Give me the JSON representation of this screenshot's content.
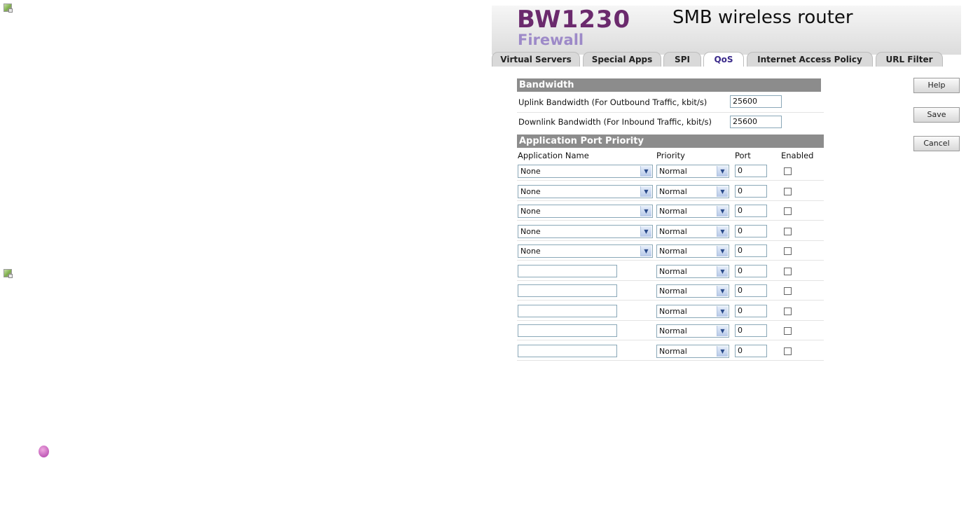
{
  "header": {
    "brand": "BW1230",
    "tagline": "SMB wireless router",
    "section": "Firewall"
  },
  "tabs": [
    {
      "label": "Virtual Servers"
    },
    {
      "label": "Special Apps"
    },
    {
      "label": "SPI"
    },
    {
      "label": "QoS"
    },
    {
      "label": "Internet Access Policy"
    },
    {
      "label": "URL Filter"
    }
  ],
  "active_tab": "QoS",
  "buttons": {
    "help": "Help",
    "save": "Save",
    "cancel": "Cancel"
  },
  "bandwidth": {
    "title": "Bandwidth",
    "uplink_label": "Uplink Bandwidth (For Outbound Traffic, kbit/s)",
    "uplink_value": "25600",
    "downlink_label": "Downlink Bandwidth (For Inbound Traffic, kbit/s)",
    "downlink_value": "25600"
  },
  "priority": {
    "title": "Application Port Priority",
    "columns": {
      "app": "Application Name",
      "priority": "Priority",
      "port": "Port",
      "enabled": "Enabled"
    },
    "rows": [
      {
        "app": "None",
        "priority": "Normal",
        "port": "0"
      },
      {
        "app": "None",
        "priority": "Normal",
        "port": "0"
      },
      {
        "app": "None",
        "priority": "Normal",
        "port": "0"
      },
      {
        "app": "None",
        "priority": "Normal",
        "port": "0"
      },
      {
        "app": "None",
        "priority": "Normal",
        "port": "0"
      },
      {
        "app": "",
        "priority": "Normal",
        "port": "0"
      },
      {
        "app": "",
        "priority": "Normal",
        "port": "0"
      },
      {
        "app": "",
        "priority": "Normal",
        "port": "0"
      },
      {
        "app": "",
        "priority": "Normal",
        "port": "0"
      },
      {
        "app": "",
        "priority": "Normal",
        "port": "0"
      }
    ]
  },
  "icons": [
    "image-placeholder-icon",
    "image-placeholder-icon",
    "bullet-dot-icon"
  ],
  "colors": {
    "brand": "#6b2a6d",
    "section": "#9d8ac8",
    "bar": "#8c8c8c"
  }
}
